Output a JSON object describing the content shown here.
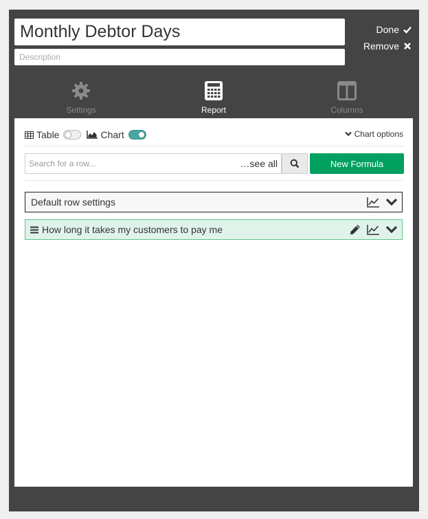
{
  "header": {
    "title": "Monthly Debtor Days",
    "description_placeholder": "Description",
    "done_label": "Done",
    "remove_label": "Remove"
  },
  "nav": {
    "tabs": [
      {
        "label": "Settings",
        "icon": "gear-icon",
        "active": false
      },
      {
        "label": "Report",
        "icon": "calculator-icon",
        "active": true
      },
      {
        "label": "Columns",
        "icon": "columns-icon",
        "active": false
      }
    ]
  },
  "toolbar": {
    "table_label": "Table",
    "table_enabled": false,
    "chart_label": "Chart",
    "chart_enabled": true,
    "chart_options_label": "Chart options",
    "search_placeholder": "Search for a row...",
    "see_all_label": "…see all",
    "new_formula_label": "New Formula"
  },
  "rows": [
    {
      "label": "Default row settings",
      "icons": [
        "line-chart-icon",
        "chevron-down-icon"
      ]
    },
    {
      "label": "How long it takes my customers to pay me",
      "icons": [
        "hamburger-icon",
        "pencil-icon",
        "line-chart-icon",
        "chevron-down-icon"
      ]
    }
  ],
  "colors": {
    "panel_bg": "#444444",
    "accent_green": "#00a060",
    "toggle_on": "#4aa7a1",
    "row_highlight": "#dff3ea"
  }
}
